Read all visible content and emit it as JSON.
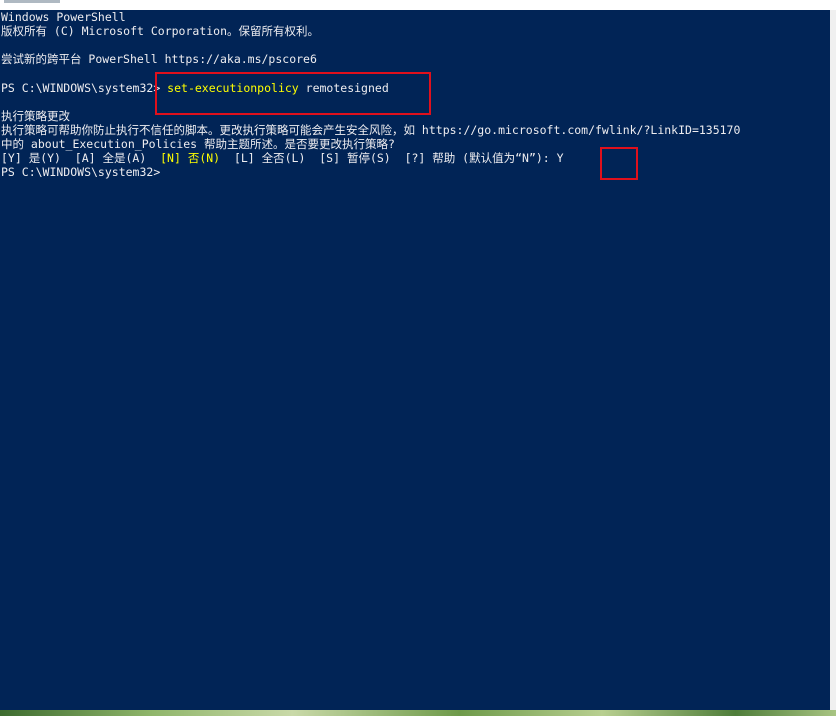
{
  "console": {
    "lines": {
      "l1": "Windows PowerShell",
      "l2": "版权所有 (C) Microsoft Corporation。保留所有权利。",
      "l3": "尝试新的跨平台 PowerShell https://aka.ms/pscore6",
      "prompt1": "PS C:\\WINDOWS\\system32> ",
      "cmd": "set-executionpolicy",
      "arg": " remotesigned",
      "l5": "执行策略更改",
      "l6": "执行策略可帮助你防止执行不信任的脚本。更改执行策略可能会产生安全风险，如 https://go.microsoft.com/fwlink/?LinkID=135170",
      "l7": "中的 about_Execution_Policies 帮助主题所述。是否要更改执行策略?",
      "l8_a": "[Y] 是(Y)  [A] 全是(A)  ",
      "l8_b": "[N] 否(N)",
      "l8_c": "  [L] 全否(L)  [S] 暂停(S)  [?] 帮助 (默认值为“N”): Y",
      "prompt2": "PS C:\\WINDOWS\\system32>"
    }
  },
  "colors": {
    "background": "#012456",
    "text": "#eeedf0",
    "command": "#ffff00",
    "annotation": "#e0101c"
  }
}
